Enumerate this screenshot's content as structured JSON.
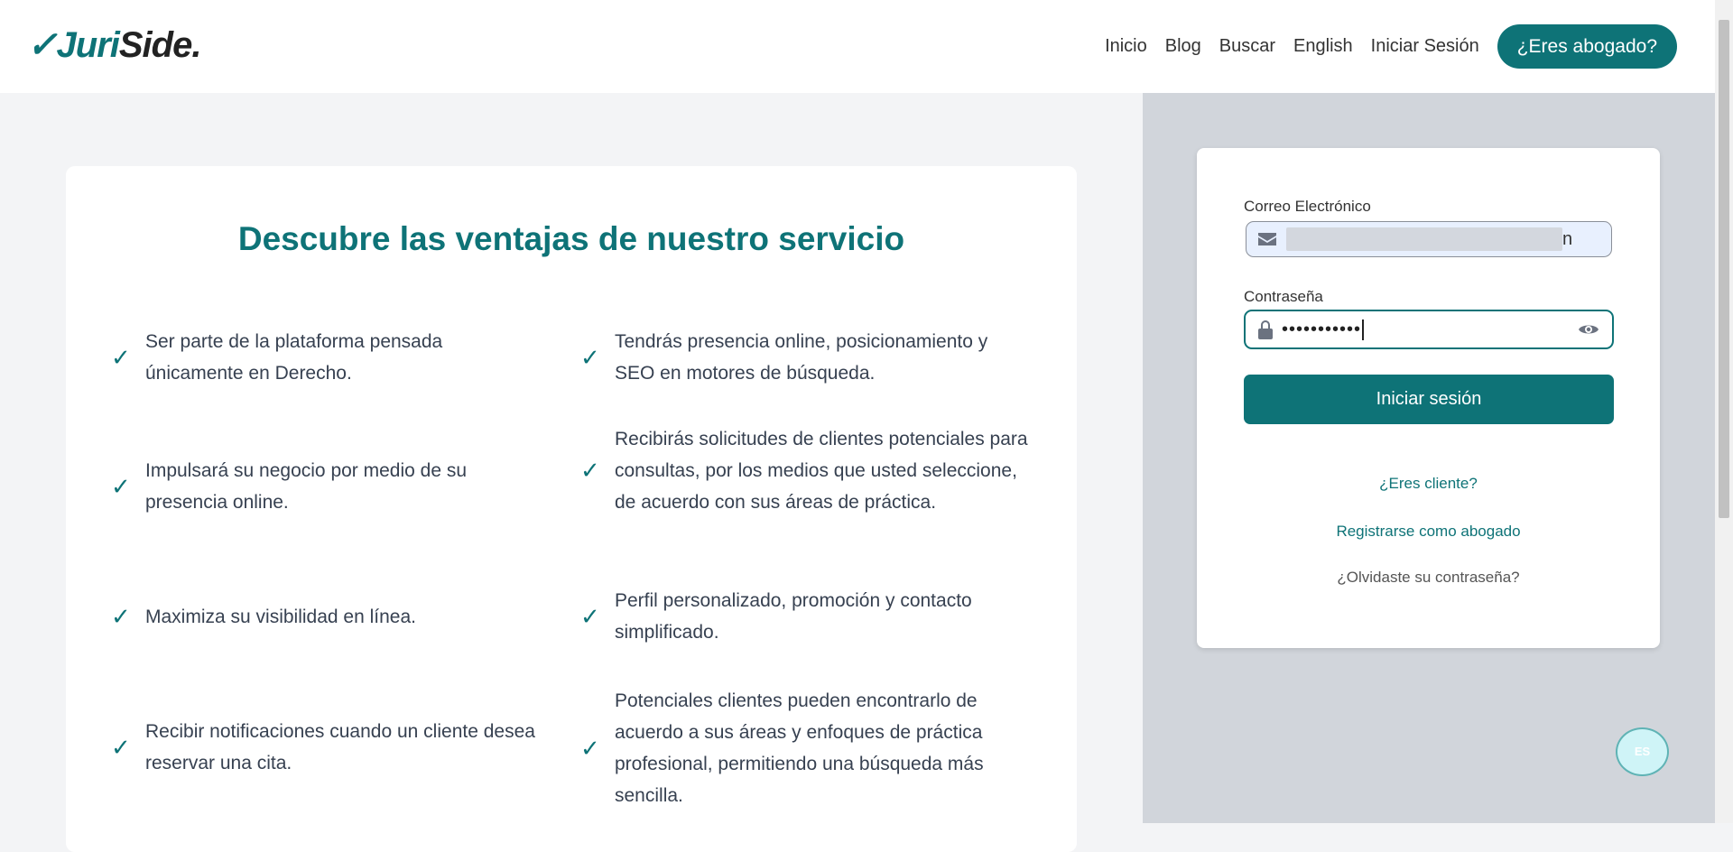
{
  "header": {
    "logo_a": "✓Juri",
    "logo_b": "Side.",
    "nav": [
      "Inicio",
      "Blog",
      "Buscar",
      "English",
      "Iniciar Sesión"
    ],
    "cta": "¿Eres abogado?"
  },
  "benefits": {
    "title": "Descubre las ventajas de nuestro servicio",
    "check": "✓",
    "items": [
      "Ser parte de la plataforma pensada únicamente en Derecho.",
      "Tendrás presencia online, posicionamiento y SEO en motores de búsqueda.",
      "Impulsará su negocio por medio de su presencia online.",
      "Recibirás solicitudes de clientes potenciales para consultas, por los medios que usted seleccione, de acuerdo con sus áreas de práctica.",
      "Maximiza su visibilidad en línea.",
      "Perfil personalizado, promoción y contacto simplificado.",
      "Recibir notificaciones cuando un cliente desea reservar una cita.",
      "Potenciales clientes pueden encontrarlo de acuerdo a sus áreas y enfoques de práctica profesional, permitiendo una búsqueda más sencilla."
    ]
  },
  "login": {
    "email_label": "Correo Electrónico",
    "email_value_tail": "n",
    "password_label": "Contraseña",
    "password_value": "•••••••••••",
    "submit": "Iniciar sesión",
    "client_link": "¿Eres cliente?",
    "register_link": "Registrarse como abogado",
    "forgot_link": "¿Olvidaste su contraseña?"
  },
  "lang_button": "ES",
  "colors": {
    "accent": "#0e7377"
  }
}
